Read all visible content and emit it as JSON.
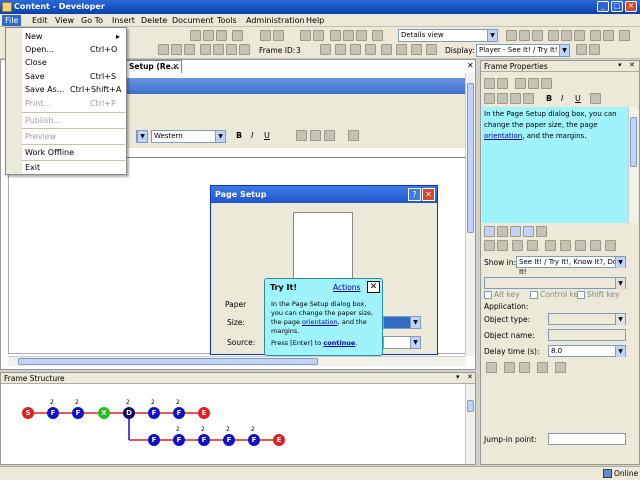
{
  "window": {
    "title": "Content - Developer"
  },
  "menu": {
    "items": [
      "File",
      "Edit",
      "View",
      "Go To",
      "Insert",
      "Delete",
      "Document",
      "Tools",
      "Administration",
      "Help"
    ]
  },
  "file_menu": {
    "new": "New",
    "new_arrow": "▸",
    "open": "Open...",
    "open_sc": "Ctrl+O",
    "close": "Close",
    "save": "Save",
    "save_sc": "Ctrl+S",
    "save_as": "Save As...",
    "save_as_sc": "Ctrl+Shift+A",
    "print": "Print...",
    "print_sc": "Ctrl+P",
    "publish": "Publish...",
    "preview": "Preview",
    "work_offline": "Work Offline",
    "exit": "Exit"
  },
  "toolbar": {
    "view_combo": "Details view",
    "frame_id_label": "Frame ID:",
    "frame_id": "3",
    "display_label": "Display:",
    "display_value": "Player - See It! / Try It!"
  },
  "editor": {
    "tab_label": "Setup (Re...",
    "font_combo": "Western",
    "format_buttons": [
      "B",
      "I",
      "U"
    ]
  },
  "page_setup": {
    "title": "Page Setup",
    "paper": "Paper",
    "size": "Size:",
    "source": "Source:"
  },
  "tooltip": {
    "title": "Try It!",
    "actions": "Actions",
    "close": "✕",
    "body_1": "In the Page Setup dialog box, you can change the paper size, the page ",
    "body_link": "orientation",
    "body_2": ", and the margins.",
    "press": "Press [Enter] to ",
    "continue": "continue",
    "press_end": "."
  },
  "frame_structure": {
    "title": "Frame Structure",
    "row1": [
      "S",
      "F",
      "F",
      "X",
      "D",
      "F",
      "F",
      "E"
    ],
    "row1_sup": [
      "",
      "2",
      "2",
      "",
      "2",
      "2",
      "2",
      ""
    ],
    "row2": [
      "F",
      "F",
      "F",
      "F",
      "F",
      "E"
    ],
    "row2_sup": [
      "",
      "2",
      "2",
      "2",
      "2",
      ""
    ]
  },
  "frame_properties": {
    "title": "Frame Properties",
    "text_1": "In the Page Setup dialog box, you can change the paper size, the page ",
    "text_link": "orientation",
    "text_2": ", and the margins.",
    "show_in_label": "Show in:",
    "show_in_value": "See It! / Try It!, Know It?, Do It!",
    "alt_key": "Alt key",
    "control_key": "Control key",
    "shift_key": "Shift key",
    "application": "Application:",
    "object_type": "Object type:",
    "object_name": "Object name:",
    "delay_label": "Delay time (s):",
    "delay_value": "8.0",
    "jump_in": "Jump-in point:"
  },
  "status": {
    "online": "Online"
  }
}
